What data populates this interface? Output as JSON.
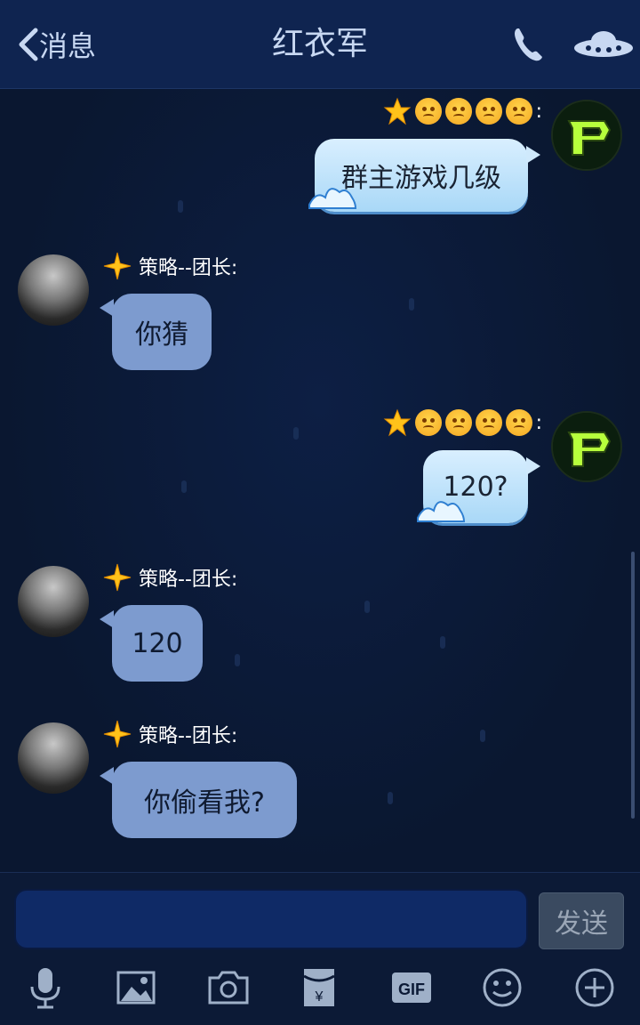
{
  "header": {
    "back_label": "消息",
    "title": "红衣军"
  },
  "messages": [
    {
      "side": "right",
      "text": "群主游戏几级"
    },
    {
      "side": "left",
      "sender": "策略--团长:",
      "text": "你猜"
    },
    {
      "side": "right",
      "text": "120?"
    },
    {
      "side": "left",
      "sender": "策略--团长:",
      "text": "120"
    },
    {
      "side": "left",
      "sender": "策略--团长:",
      "text": "你偷看我?"
    }
  ],
  "self_suffix": ":",
  "input": {
    "placeholder": "",
    "send_label": "发送"
  },
  "colors": {
    "background": "#0a1730",
    "header": "#0f2450",
    "bubble_right": "#a9d8f7",
    "bubble_left": "#7d9bcf"
  },
  "toolbar_icons": [
    "microphone-icon",
    "image-icon",
    "camera-icon",
    "red-packet-icon",
    "gif-icon",
    "emoji-icon",
    "plus-icon"
  ]
}
